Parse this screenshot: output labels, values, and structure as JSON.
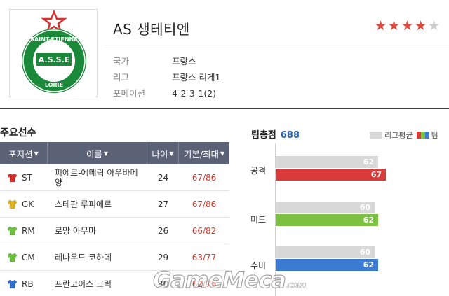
{
  "team": {
    "name": "AS 생테티엔",
    "logo_text_top": "SAINT-ETIENNE",
    "logo_text_mid": "A.S.S.E",
    "logo_text_bottom": "LOIRE",
    "stars_filled": 4,
    "stars_total": 5,
    "info": {
      "country_label": "국가",
      "country": "프랑스",
      "league_label": "리그",
      "league": "프랑스 리게1",
      "formation_label": "포메이션",
      "formation": "4-2-3-1(2)"
    }
  },
  "players": {
    "title": "주요선수",
    "headers": {
      "position": "포지션",
      "name": "이름",
      "age": "나이",
      "stat": "기본/최대"
    },
    "rows": [
      {
        "position": "ST",
        "name": "피에르-에메릭 아우바메양",
        "age": "24",
        "stat": "67/86",
        "jersey_color": "#d92d2d",
        "jersey_icon": "shirt-red-icon"
      },
      {
        "position": "GK",
        "name": "스테판 루피에르",
        "age": "27",
        "stat": "67/86",
        "jersey_color": "#e3b21f",
        "jersey_icon": "shirt-yellow-icon"
      },
      {
        "position": "RM",
        "name": "로망 아무마",
        "age": "26",
        "stat": "66/82",
        "jersey_color": "#6cc23a",
        "jersey_icon": "shirt-green-icon"
      },
      {
        "position": "CM",
        "name": "레나우드 코하데",
        "age": "29",
        "stat": "63/77",
        "jersey_color": "#6cc23a",
        "jersey_icon": "shirt-green-icon"
      },
      {
        "position": "RB",
        "name": "프란코이스 크럭",
        "age": "30",
        "stat": "62/76",
        "jersey_color": "#2f6fd1",
        "jersey_icon": "shirt-blue-icon"
      }
    ]
  },
  "team_stats": {
    "title": "팀총점",
    "total": "688",
    "legend_avg": "리그평균",
    "legend_team": "팀",
    "colors": {
      "avg": "#d8d8d8",
      "attack": "#d93a3a",
      "mid": "#7cc142",
      "defense": "#3b7bd4"
    },
    "categories": [
      {
        "label": "공격",
        "avg": 62,
        "team": 67
      },
      {
        "label": "미드",
        "avg": 60,
        "team": 62
      },
      {
        "label": "수비",
        "avg": 60,
        "team": 62
      }
    ]
  },
  "watermark": {
    "text": "GameMeca",
    "suffix": ".com"
  }
}
